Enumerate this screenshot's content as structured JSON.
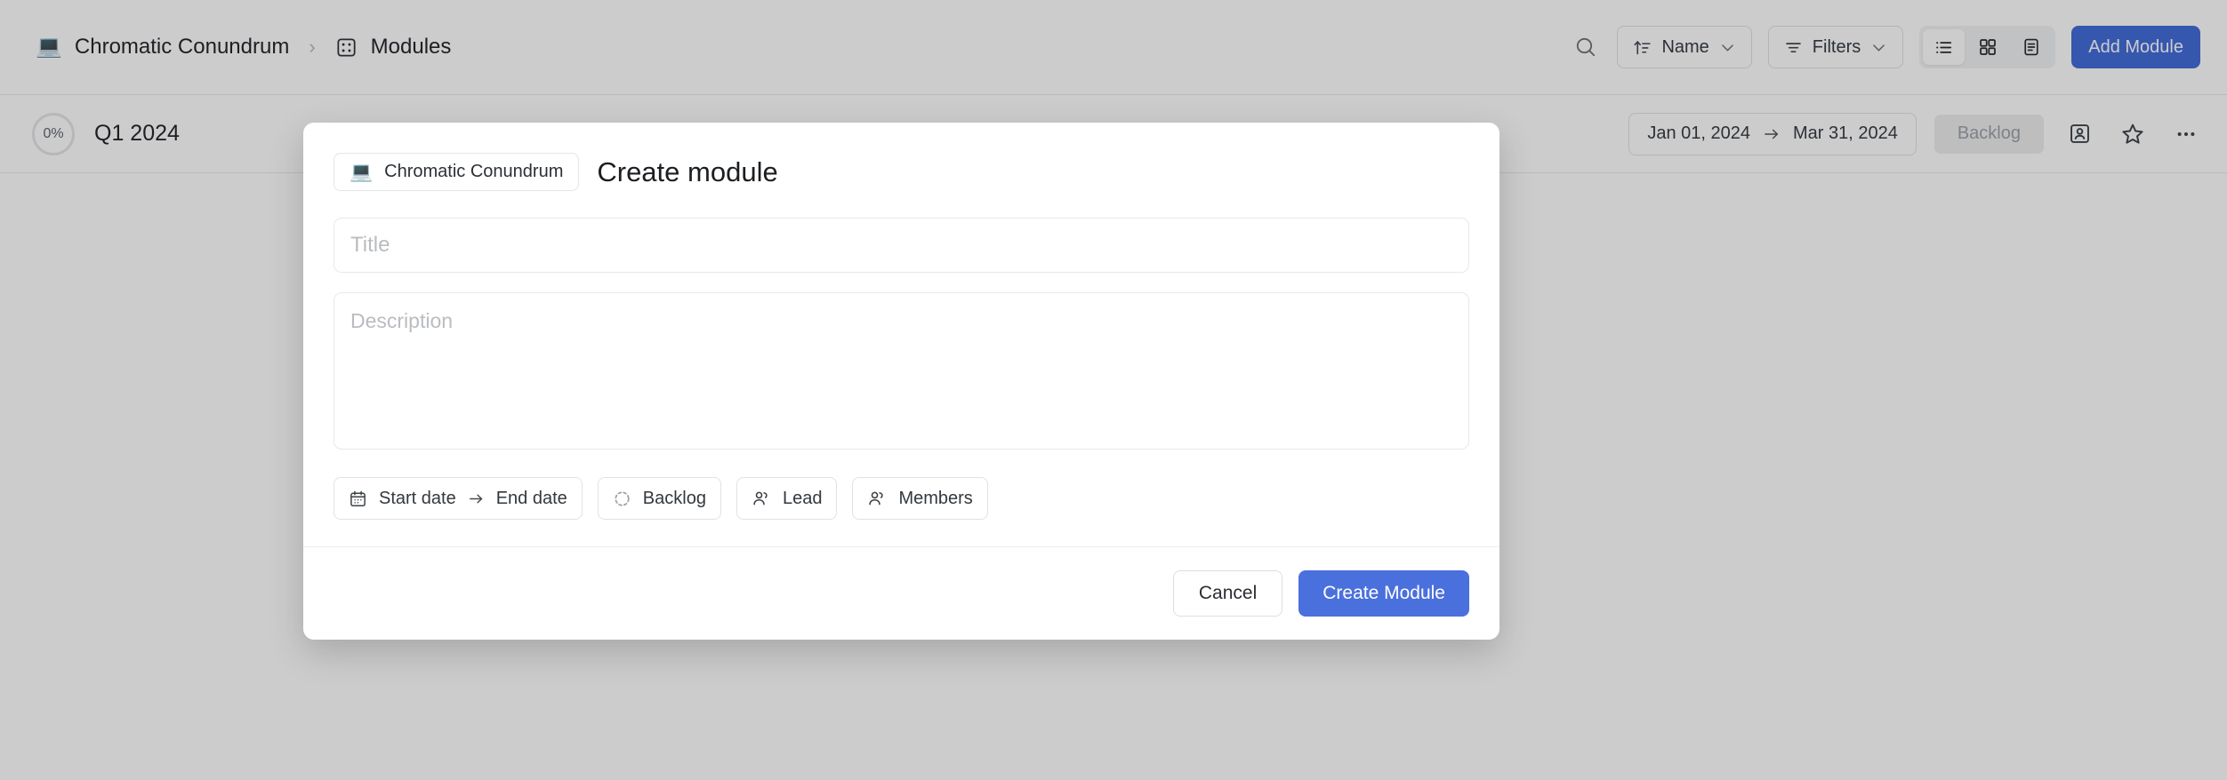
{
  "topbar": {
    "breadcrumb": {
      "project_emoji": "💻",
      "project_name": "Chromatic Conundrum",
      "separator": "›",
      "section_icon": "modules-icon",
      "section_name": "Modules"
    },
    "search_icon": "search-icon",
    "sort_button": {
      "label": "Name",
      "icon": "sort-ascending-icon",
      "chevron": "chevron-down-icon"
    },
    "filters_button": {
      "label": "Filters",
      "icon": "filter-icon",
      "chevron": "chevron-down-icon"
    },
    "view_toggle": {
      "options": [
        {
          "name": "list-view",
          "icon": "list-icon",
          "active": true
        },
        {
          "name": "grid-view",
          "icon": "grid-icon",
          "active": false
        },
        {
          "name": "spreadsheet-view",
          "icon": "spreadsheet-icon",
          "active": false
        }
      ]
    },
    "add_module_label": "Add  Module",
    "accent_color": "#3f6ad8"
  },
  "subheader": {
    "progress_percent": "0%",
    "cycle_title": "Q1 2024",
    "date_range": {
      "start": "Jan 01, 2024",
      "arrow": "→",
      "end": "Mar 31, 2024"
    },
    "state_label": "Backlog",
    "icons": [
      {
        "name": "contact-card-icon"
      },
      {
        "name": "star-icon"
      },
      {
        "name": "more-options-icon"
      }
    ]
  },
  "modal": {
    "project_chip": {
      "emoji": "💻",
      "label": "Chromatic Conundrum"
    },
    "title": "Create module",
    "title_input": {
      "value": "",
      "placeholder": "Title"
    },
    "description_input": {
      "value": "",
      "placeholder": "Description"
    },
    "chips": [
      {
        "name": "date-range-chip",
        "icon": "calendar-icon",
        "start_label": "Start date",
        "arrow": "→",
        "end_label": "End date"
      },
      {
        "name": "status-chip",
        "icon": "backlog-circle-icon",
        "label": "Backlog"
      },
      {
        "name": "lead-chip",
        "icon": "users-icon",
        "label": "Lead"
      },
      {
        "name": "members-chip",
        "icon": "users-icon",
        "label": "Members"
      }
    ],
    "cancel_label": "Cancel",
    "submit_label": "Create Module",
    "submit_color": "#4a70dd"
  }
}
